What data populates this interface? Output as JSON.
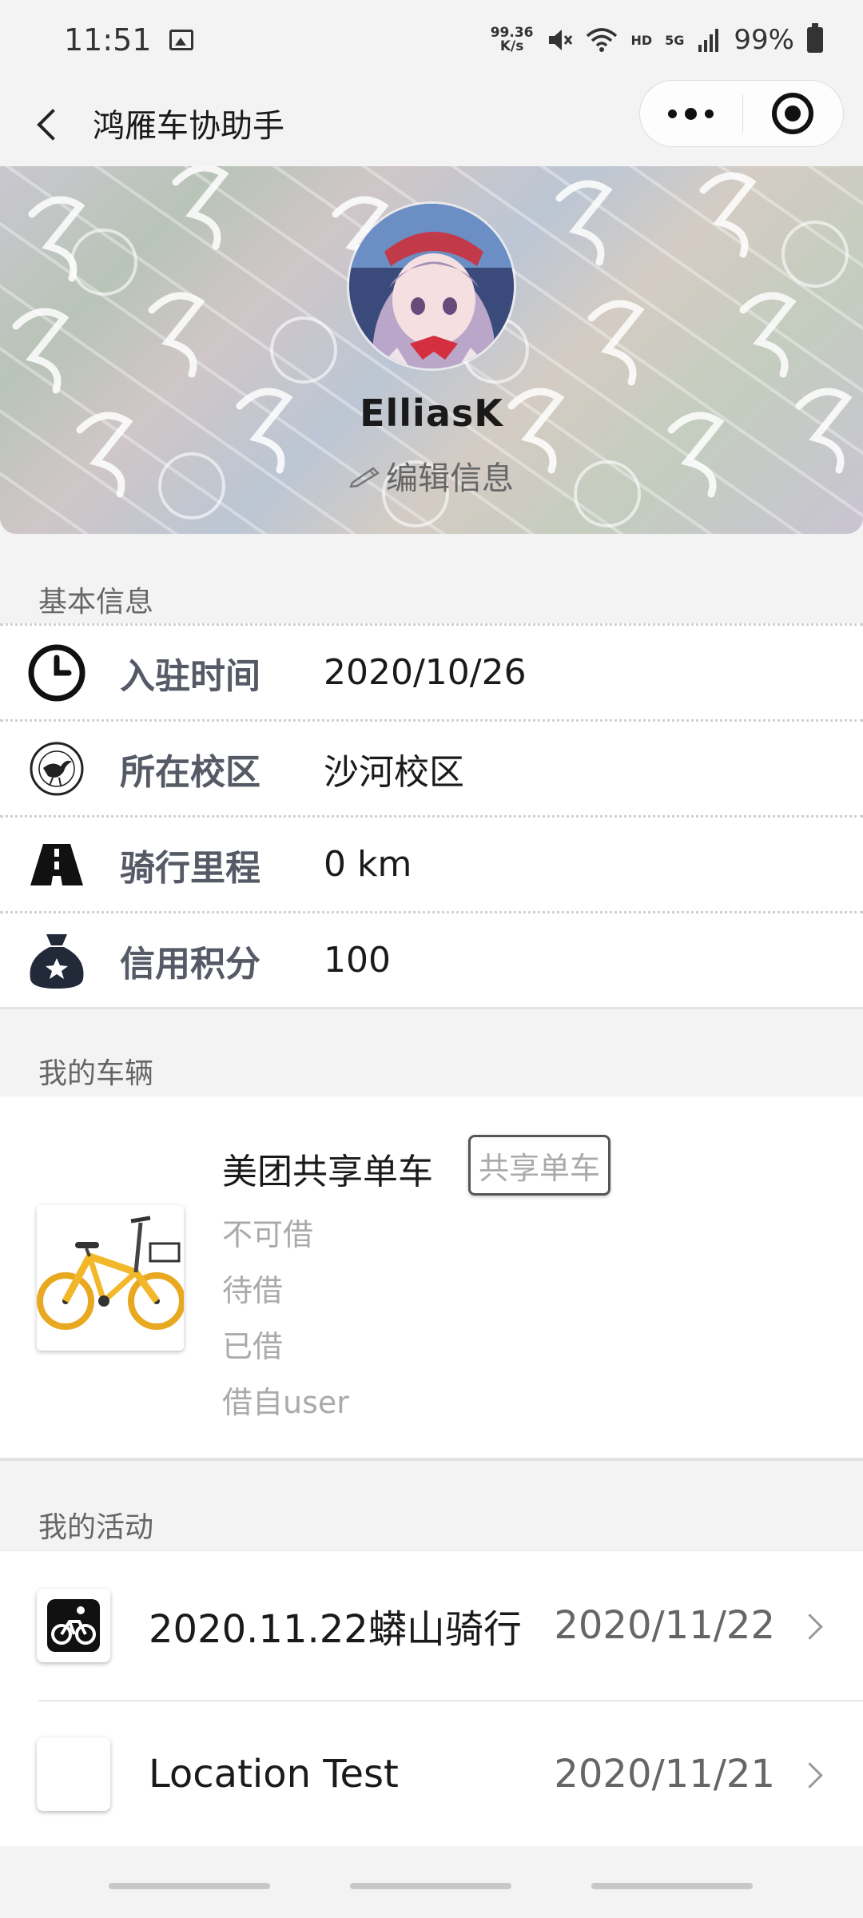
{
  "status_bar": {
    "time": "11:51",
    "net_speed_value": "99.36",
    "net_speed_unit": "K/s",
    "hd": "HD",
    "network": "5G",
    "battery": "99%"
  },
  "nav": {
    "title": "鸿雁车协助手"
  },
  "profile": {
    "username": "ElliasK",
    "edit_label": "编辑信息"
  },
  "sections": {
    "basic_info": "基本信息",
    "my_vehicles": "我的车辆",
    "my_activities": "我的活动"
  },
  "basic_info": [
    {
      "label": "入驻时间",
      "value": "2020/10/26",
      "icon": "clock-icon"
    },
    {
      "label": "所在校区",
      "value": "沙河校区",
      "icon": "school-emblem-icon"
    },
    {
      "label": "骑行里程",
      "value": "0 km",
      "icon": "road-icon"
    },
    {
      "label": "信用积分",
      "value": "100",
      "icon": "money-bag-star-icon"
    }
  ],
  "vehicle": {
    "name": "美团共享单车",
    "tag": "共享单车",
    "statuses": [
      "不可借",
      "待借",
      "已借",
      "借自user"
    ]
  },
  "activities": [
    {
      "title": "2020.11.22蟒山骑行",
      "date": "2020/11/22"
    },
    {
      "title": "Location Test",
      "date": "2020/11/21"
    }
  ],
  "colors": {
    "label_gray": "#555a66",
    "muted": "#aaaaaa",
    "background": "#f3f3f3"
  }
}
